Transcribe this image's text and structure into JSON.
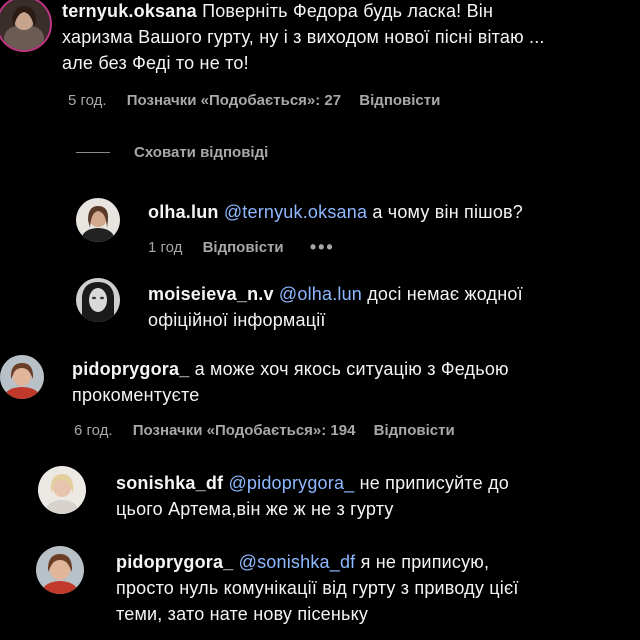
{
  "comments": [
    {
      "username": "ternyuk.oksana",
      "text_lines": [
        "Поверніть Федора будь ласка! Він",
        "харизма Вашого гурту, ну і з виходом нової пісні вітаю ...",
        "але без Феді то не то!"
      ],
      "time": "5 год.",
      "likes": "Позначки «Подобається»: 27",
      "reply": "Відповісти"
    },
    {
      "username": "pidoprygora_",
      "text_lines": [
        "а може хоч якось ситуацію з Федьою",
        "прокоментуєте"
      ],
      "time": "6 год.",
      "likes": "Позначки «Подобається»: 194",
      "reply": "Відповісти"
    }
  ],
  "hide_replies": "Сховати відповіді",
  "replies": [
    {
      "username": "olha.lun",
      "mention": "@ternyuk.oksana",
      "text_lines": [
        "а чому він пішов?"
      ],
      "time": "1 год",
      "reply": "Відповісти",
      "more": "•••"
    },
    {
      "username": "moiseieva_n.v",
      "mention": "@olha.lun",
      "text_lines": [
        "досі немає жодної",
        "офіційної інформації"
      ]
    },
    {
      "username": "sonishka_df",
      "mention": "@pidoprygora_",
      "text_lines": [
        "не приписуйте до",
        "цього Артема,він же ж не з гурту"
      ]
    },
    {
      "username": "pidoprygora_",
      "mention": "@sonishka_df",
      "text_lines": [
        "я не приписую,",
        "просто нуль комунікації від гурту з приводу цієї",
        "теми, зато нате нову пісеньку"
      ]
    }
  ],
  "colors": {
    "background": "#000000",
    "text": "#f5f5f5",
    "secondary": "#a8a8a8",
    "mention": "#8eb8ff"
  },
  "icons": {
    "more": "more-options-icon"
  }
}
